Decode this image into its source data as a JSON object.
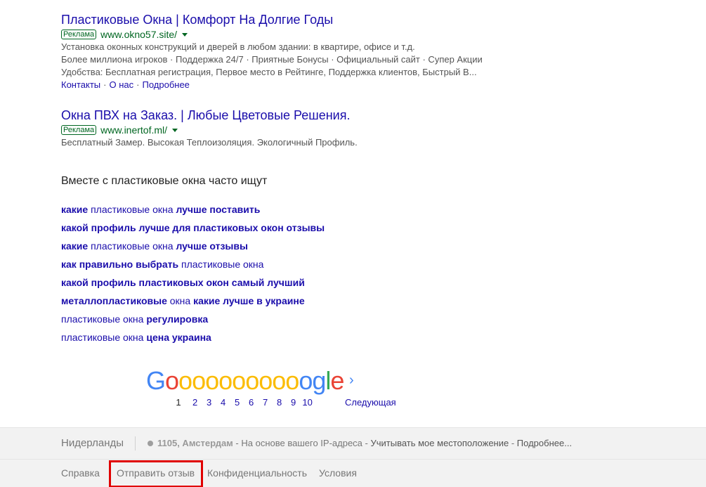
{
  "ads": [
    {
      "title": "Пластиковые Окна | Комфорт На Долгие Годы",
      "badge": "Реклама",
      "url": "www.okno57.site/",
      "lines": [
        "Установка оконных конструкций и дверей в любом здании: в квартире, офисе и т.д.",
        "Более миллиона игроков · Поддержка 24/7 · Приятные Бонусы · Официальный сайт · Супер Акции",
        "Удобства: Бесплатная регистрация, Первое место в Рейтинге, Поддержка клиентов, Быстрый В..."
      ],
      "sitelinks": [
        "Контакты",
        "О нас",
        "Подробнее"
      ],
      "sitelink_sep": "·"
    },
    {
      "title": "Окна ПВХ на Заказ. | Любые Цветовые Решения.",
      "badge": "Реклама",
      "url": "www.inertof.ml/",
      "lines": [
        "Бесплатный Замер. Высокая Теплоизоляция. Экологичный Профиль."
      ]
    }
  ],
  "related": {
    "heading": "Вместе с пластиковые окна часто ищут",
    "items": [
      {
        "b1": "какие",
        "t1": " пластиковые окна ",
        "b2": "лучше поставить",
        "t2": ""
      },
      {
        "b1": "какой профиль лучше для пластиковых окон отзывы",
        "t1": "",
        "b2": "",
        "t2": ""
      },
      {
        "b1": "какие",
        "t1": " пластиковые окна ",
        "b2": "лучше отзывы",
        "t2": ""
      },
      {
        "b1": "как правильно выбрать",
        "t1": " пластиковые окна",
        "b2": "",
        "t2": ""
      },
      {
        "b1": "какой профиль пластиковых окон самый лучший",
        "t1": "",
        "b2": "",
        "t2": ""
      },
      {
        "b1": "металлопластиковые",
        "t1": " окна ",
        "b2": "какие лучше в украине",
        "t2": ""
      },
      {
        "b1": "",
        "t1": "пластиковые окна ",
        "b2": "регулировка",
        "t2": ""
      },
      {
        "b1": "",
        "t1": "пластиковые окна ",
        "b2": "цена украина",
        "t2": ""
      }
    ]
  },
  "pagination": {
    "logo_letters": [
      "G",
      "o",
      "o",
      "o",
      "o",
      "o",
      "o",
      "o",
      "o",
      "o",
      "o",
      "o",
      "g",
      "l",
      "e"
    ],
    "logo_colors": [
      "b",
      "r",
      "y",
      "y",
      "y",
      "y",
      "y",
      "y",
      "y",
      "y",
      "y",
      "b",
      "b",
      "g",
      "r"
    ],
    "current_page": "1",
    "pages": [
      "2",
      "3",
      "4",
      "5",
      "6",
      "7",
      "8",
      "9",
      "10"
    ],
    "next_arrow": "›",
    "next_label": "Следующая"
  },
  "footer": {
    "country": "Нидерланды",
    "location_city": "1105, Амстердам",
    "location_dash1": " - ",
    "location_basis": "На основе вашего IP-адреса",
    "location_dash2": " - ",
    "location_use": "Учитывать мое местоположение",
    "location_dash3": " - ",
    "location_more": "Подробнее...",
    "links": {
      "help": "Справка",
      "feedback": "Отправить отзыв",
      "privacy": "Конфиденциальность",
      "terms": "Условия"
    },
    "highlight_color": "#e00000"
  }
}
